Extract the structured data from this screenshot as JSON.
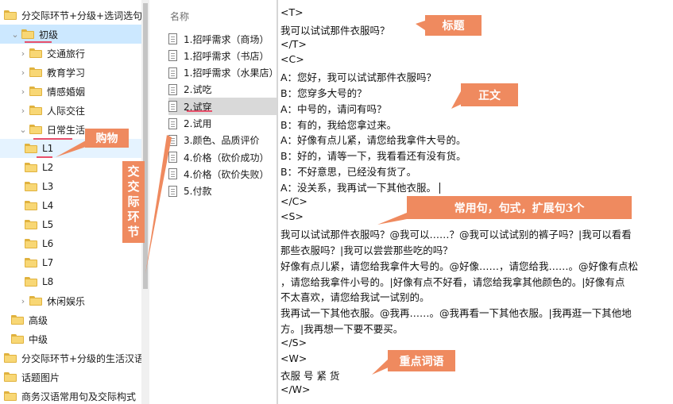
{
  "tree": {
    "items": [
      {
        "label": "分交际环节+分级+选词选句",
        "chevron": "",
        "level": 0,
        "state": ""
      },
      {
        "label": "初级",
        "chevron": "⌄",
        "level": 1,
        "state": "selected"
      },
      {
        "label": "交通旅行",
        "chevron": "›",
        "level": 2,
        "state": ""
      },
      {
        "label": "教育学习",
        "chevron": "›",
        "level": 2,
        "state": ""
      },
      {
        "label": "情感婚姻",
        "chevron": "›",
        "level": 2,
        "state": ""
      },
      {
        "label": "人际交往",
        "chevron": "›",
        "level": 2,
        "state": ""
      },
      {
        "label": "日常生活",
        "chevron": "⌄",
        "level": 2,
        "state": ""
      },
      {
        "label": "L1",
        "chevron": "",
        "level": 3,
        "state": "hover"
      },
      {
        "label": "L2",
        "chevron": "",
        "level": 3,
        "state": ""
      },
      {
        "label": "L3",
        "chevron": "",
        "level": 3,
        "state": ""
      },
      {
        "label": "L4",
        "chevron": "",
        "level": 3,
        "state": ""
      },
      {
        "label": "L5",
        "chevron": "",
        "level": 3,
        "state": ""
      },
      {
        "label": "L6",
        "chevron": "",
        "level": 3,
        "state": ""
      },
      {
        "label": "L7",
        "chevron": "",
        "level": 3,
        "state": ""
      },
      {
        "label": "L8",
        "chevron": "",
        "level": 3,
        "state": ""
      },
      {
        "label": "休闲娱乐",
        "chevron": "›",
        "level": 2,
        "state": ""
      },
      {
        "label": "高级",
        "chevron": "",
        "level": 1,
        "state": ""
      },
      {
        "label": "中级",
        "chevron": "",
        "level": 1,
        "state": ""
      },
      {
        "label": "分交际环节+分级的生活汉语",
        "chevron": "",
        "level": 0,
        "state": ""
      },
      {
        "label": "话题图片",
        "chevron": "",
        "level": 0,
        "state": ""
      },
      {
        "label": "商务汉语常用句及交际构式",
        "chevron": "",
        "level": 0,
        "state": ""
      }
    ]
  },
  "files": {
    "header": "名称",
    "items": [
      {
        "label": "1.招呼需求（商场）",
        "state": ""
      },
      {
        "label": "1.招呼需求（书店）",
        "state": ""
      },
      {
        "label": "1.招呼需求（水果店）",
        "state": ""
      },
      {
        "label": "2.试吃",
        "state": ""
      },
      {
        "label": "2.试穿",
        "state": "selected"
      },
      {
        "label": "2.试用",
        "state": ""
      },
      {
        "label": "3.颜色、品质评价",
        "state": ""
      },
      {
        "label": "4.价格（砍价成功）",
        "state": ""
      },
      {
        "label": "4.价格（砍价失败）",
        "state": ""
      },
      {
        "label": "5.付款",
        "state": ""
      }
    ]
  },
  "document": {
    "lines": [
      "<T>",
      "我可以试试那件衣服吗？",
      "</T>",
      "<C>",
      "A：您好，我可以试试那件衣服吗？",
      "B：您穿多大号的？",
      "A：中号的，请问有吗？",
      "B：有的，我给您拿过来。",
      "A：好像有点儿紧，请您给我拿件大号的。",
      "B：好的，请等一下，我看看还有没有货。",
      "B：不好意思，已经没有货了。",
      "A：没关系，我再试一下其他衣服。",
      "</C>",
      "<S>",
      "我可以试试那件衣服吗？@我可以……？@我可以试试别的裤子吗？|我可以看看",
      "那些衣服吗？|我可以尝尝那些吃的吗？",
      "好像有点儿紧，请您给我拿件大号的。@好像……，请您给我……。@好像有点松",
      "，请您给我拿件小号的。|好像有点不好看，请您给我拿其他颜色的。|好像有点",
      "不太喜欢，请您给我试一试别的。",
      "我再试一下其他衣服。@我再……。@我再看一下其他衣服。|我再逛一下其他地",
      "方。|我再想一下要不要买。",
      "</S>",
      "<W>",
      "衣服 号 紧 货",
      "</W>"
    ]
  },
  "annotations": {
    "title_label": "标题",
    "body_label": "正文",
    "sentences_label": "常用句，句式，扩展句3个",
    "keywords_label": "重点词语",
    "shopping_label": "购物",
    "stage_label": "交交际环节",
    "color": "#ef8a5f",
    "underline_color": "#e8506b"
  }
}
